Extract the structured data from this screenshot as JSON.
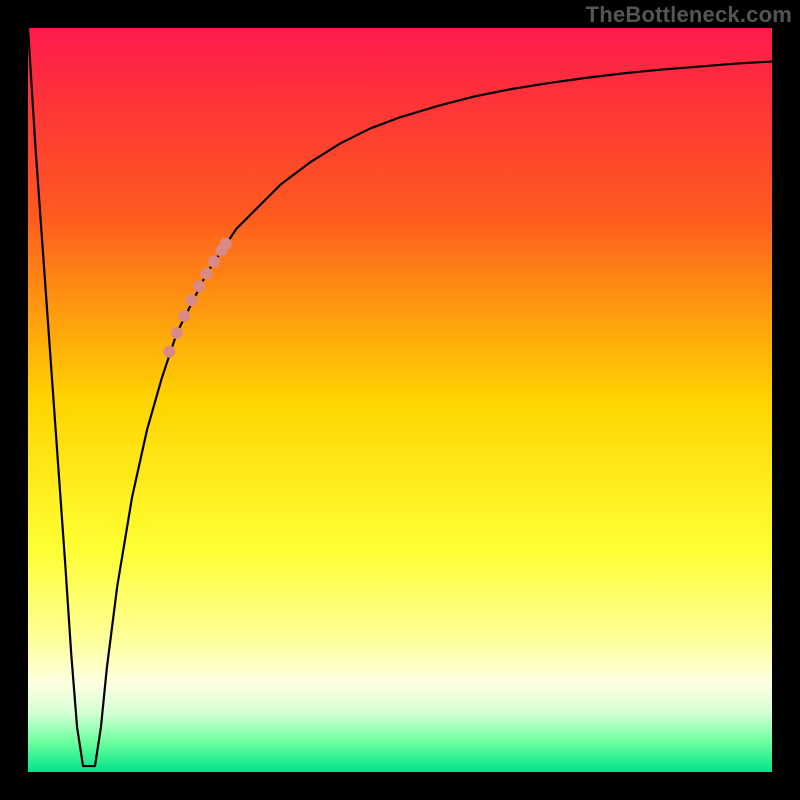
{
  "watermark": "TheBottleneck.com",
  "chart_data": {
    "type": "line",
    "title": "",
    "xlabel": "",
    "ylabel": "",
    "xlim": [
      0,
      100
    ],
    "ylim": [
      0,
      100
    ],
    "grid": false,
    "legend": false,
    "gradient_stops": [
      {
        "offset": 0.0,
        "color": "#ff1a4b"
      },
      {
        "offset": 0.25,
        "color": "#ff5a1f"
      },
      {
        "offset": 0.5,
        "color": "#ffd400"
      },
      {
        "offset": 0.7,
        "color": "#ffff33"
      },
      {
        "offset": 0.82,
        "color": "#ffff99"
      },
      {
        "offset": 0.88,
        "color": "#fdffe0"
      },
      {
        "offset": 0.92,
        "color": "#d6ffd6"
      },
      {
        "offset": 0.96,
        "color": "#6dff9e"
      },
      {
        "offset": 1.0,
        "color": "#00e38a"
      }
    ],
    "series": [
      {
        "name": "left-branch",
        "x": [
          0.0,
          0.5,
          1.0,
          2.0,
          3.0,
          4.0,
          5.0,
          5.8,
          6.6,
          7.4
        ],
        "y": [
          100,
          92,
          84,
          70,
          56,
          42,
          28,
          16,
          6,
          0.8
        ]
      },
      {
        "name": "valley-floor",
        "x": [
          7.4,
          8.2,
          9.0
        ],
        "y": [
          0.8,
          0.8,
          0.8
        ]
      },
      {
        "name": "right-branch",
        "x": [
          9.0,
          9.8,
          10.6,
          12,
          14,
          16,
          18,
          20,
          22,
          24,
          26,
          28,
          30,
          34,
          38,
          42,
          46,
          50,
          55,
          60,
          65,
          70,
          75,
          80,
          85,
          90,
          95,
          100
        ],
        "y": [
          0.8,
          6,
          14,
          25,
          37,
          46,
          53,
          59,
          63,
          67,
          70,
          73,
          75,
          79,
          82,
          84.5,
          86.5,
          88,
          89.5,
          90.8,
          91.8,
          92.6,
          93.3,
          93.9,
          94.4,
          94.8,
          95.2,
          95.5
        ]
      }
    ],
    "highlight": {
      "name": "highlight-dots",
      "color": "#d98a85",
      "radius": 6,
      "x": [
        19.0,
        20.0,
        21.0,
        22.0,
        23.0,
        24.0,
        25.0,
        26.0,
        26.6
      ],
      "y": [
        56.5,
        59.0,
        61.3,
        63.4,
        65.3,
        67.0,
        68.6,
        70.1,
        71.0
      ],
      "gap_after_index": 0
    }
  }
}
